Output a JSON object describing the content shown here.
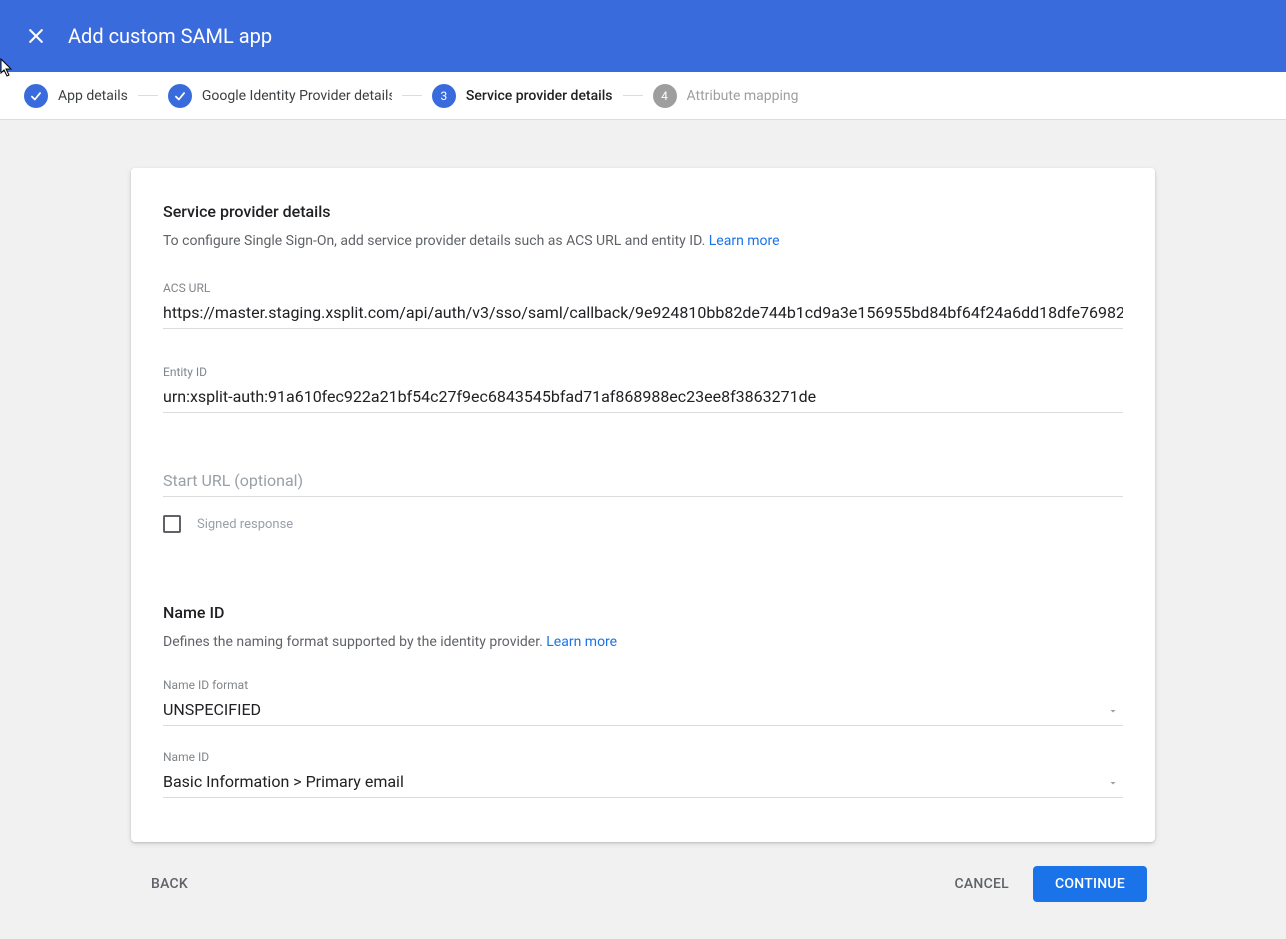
{
  "header": {
    "title": "Add custom SAML app"
  },
  "stepper": {
    "step1": "App details",
    "step2": "Google Identity Provider details",
    "step3_num": "3",
    "step3": "Service provider details",
    "step4_num": "4",
    "step4": "Attribute mapping"
  },
  "section1": {
    "title": "Service provider details",
    "desc": "To configure Single Sign-On, add service provider details such as ACS URL and entity ID. ",
    "learn": "Learn more"
  },
  "fields": {
    "acs_label": "ACS URL",
    "acs_value": "https://master.staging.xsplit.com/api/auth/v3/sso/saml/callback/9e924810bb82de744b1cd9a3e156955bd84bf64f24a6dd18dfe76982",
    "entity_label": "Entity ID",
    "entity_value": "urn:xsplit-auth:91a610fec922a21bf54c27f9ec6843545bfad71af868988ec23ee8f3863271de",
    "start_placeholder": "Start URL (optional)",
    "start_value": "",
    "signed_label": "Signed response"
  },
  "section2": {
    "title": "Name ID",
    "desc": "Defines the naming format supported by the identity provider. ",
    "learn": "Learn more"
  },
  "selects": {
    "format_label": "Name ID format",
    "format_value": "UNSPECIFIED",
    "nameid_label": "Name ID",
    "nameid_value": "Basic Information > Primary email"
  },
  "footer": {
    "back": "BACK",
    "cancel": "CANCEL",
    "continue": "CONTINUE"
  }
}
